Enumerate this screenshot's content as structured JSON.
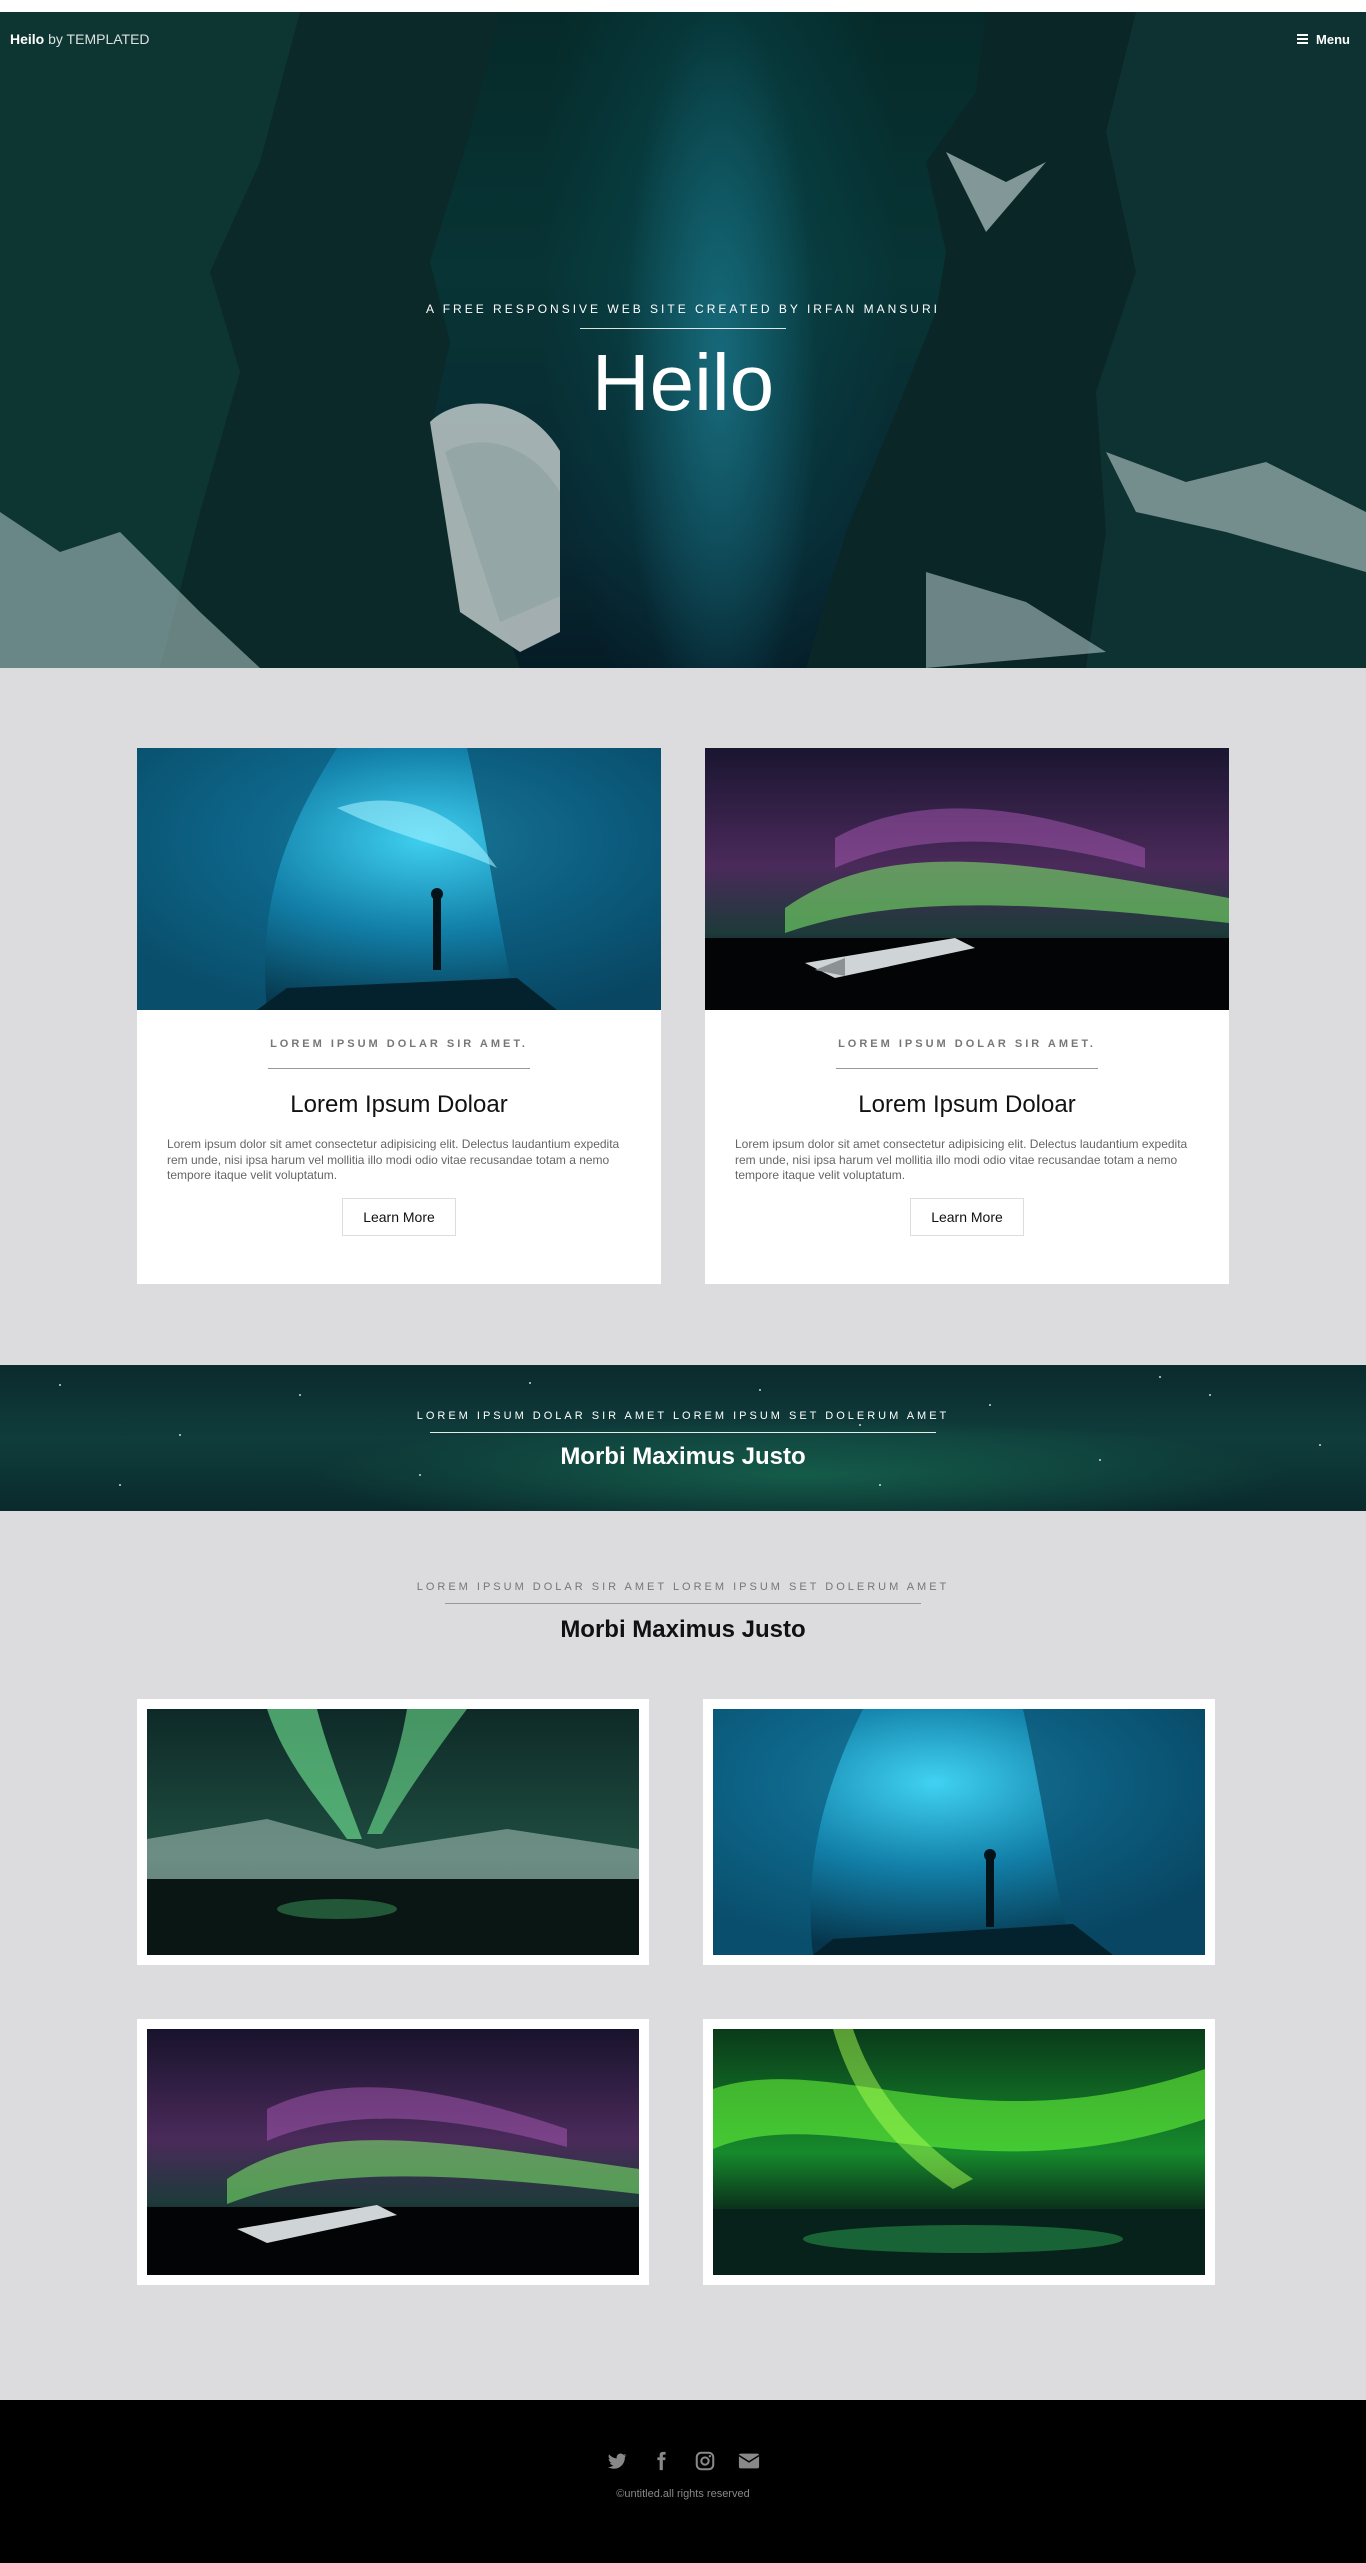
{
  "header": {
    "logo_name": "Heilo",
    "logo_by": "by TEMPLATED",
    "menu_label": "Menu"
  },
  "hero": {
    "kicker": "A FREE RESPONSIVE WEB SITE CREATED BY IRFAN MANSURI",
    "title": "Heilo"
  },
  "cards": [
    {
      "kicker": "LOREM IPSUM DOLAR SIR AMET.",
      "title": "Lorem Ipsum Doloar",
      "text": "Lorem ipsum dolor sit amet consectetur adipisicing elit. Delectus laudantium expedita rem unde, nisi ipsa harum vel mollitia illo modi odio vitae recusandae totam a nemo tempore itaque velit voluptatum.",
      "button": "Learn More"
    },
    {
      "kicker": "LOREM IPSUM DOLAR SIR AMET.",
      "title": "Lorem Ipsum Doloar",
      "text": "Lorem ipsum dolor sit amet consectetur adipisicing elit. Delectus laudantium expedita rem unde, nisi ipsa harum vel mollitia illo modi odio vitae recusandae totam a nemo tempore itaque velit voluptatum.",
      "button": "Learn More"
    }
  ],
  "banner": {
    "kicker": "LOREM IPSUM DOLAR SIR AMET LOREM IPSUM SET DOLERUM AMET",
    "title": "Morbi Maximus Justo"
  },
  "gallery_section": {
    "kicker": "LOREM IPSUM DOLAR SIR AMET LOREM IPSUM SET DOLERUM AMET",
    "title": "Morbi Maximus Justo"
  },
  "footer": {
    "social_icons": [
      "twitter-icon",
      "facebook-icon",
      "instagram-icon",
      "envelope-icon"
    ],
    "copyright": "©untitled.all rights reserved"
  },
  "colors": {
    "section_bg": "#dcdcde",
    "footer_bg": "#000000",
    "hero_teal": "#0a3c3d"
  }
}
